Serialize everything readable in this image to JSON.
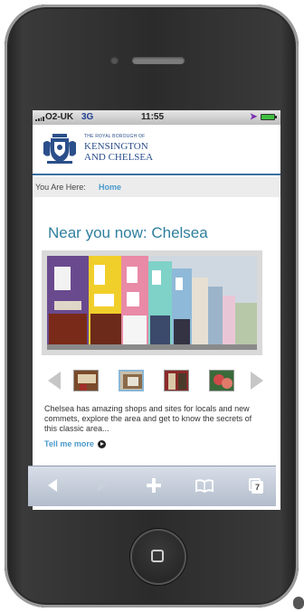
{
  "status_bar": {
    "carrier": "O2-UK",
    "network": "3G",
    "time": "11:55"
  },
  "header": {
    "org_line1": "THE ROYAL BOROUGH OF",
    "org_line2": "KENSINGTON",
    "org_line3": "AND CHELSEA"
  },
  "breadcrumb": {
    "label": "You Are Here:",
    "current": "Home"
  },
  "main": {
    "title": "Near you now: Chelsea",
    "description": "Chelsea has amazing shops and sites for locals and new commets, explore the area and get to know the secrets of this classic area...",
    "link_label": "Tell me more"
  },
  "gallery": {
    "selected_index": 1,
    "thumbnail_count": 4
  },
  "toolbar": {
    "pages_count": "7"
  },
  "colors": {
    "accent": "#2f7f9e",
    "link": "#4a9acb",
    "brand": "#2a4f8a"
  }
}
